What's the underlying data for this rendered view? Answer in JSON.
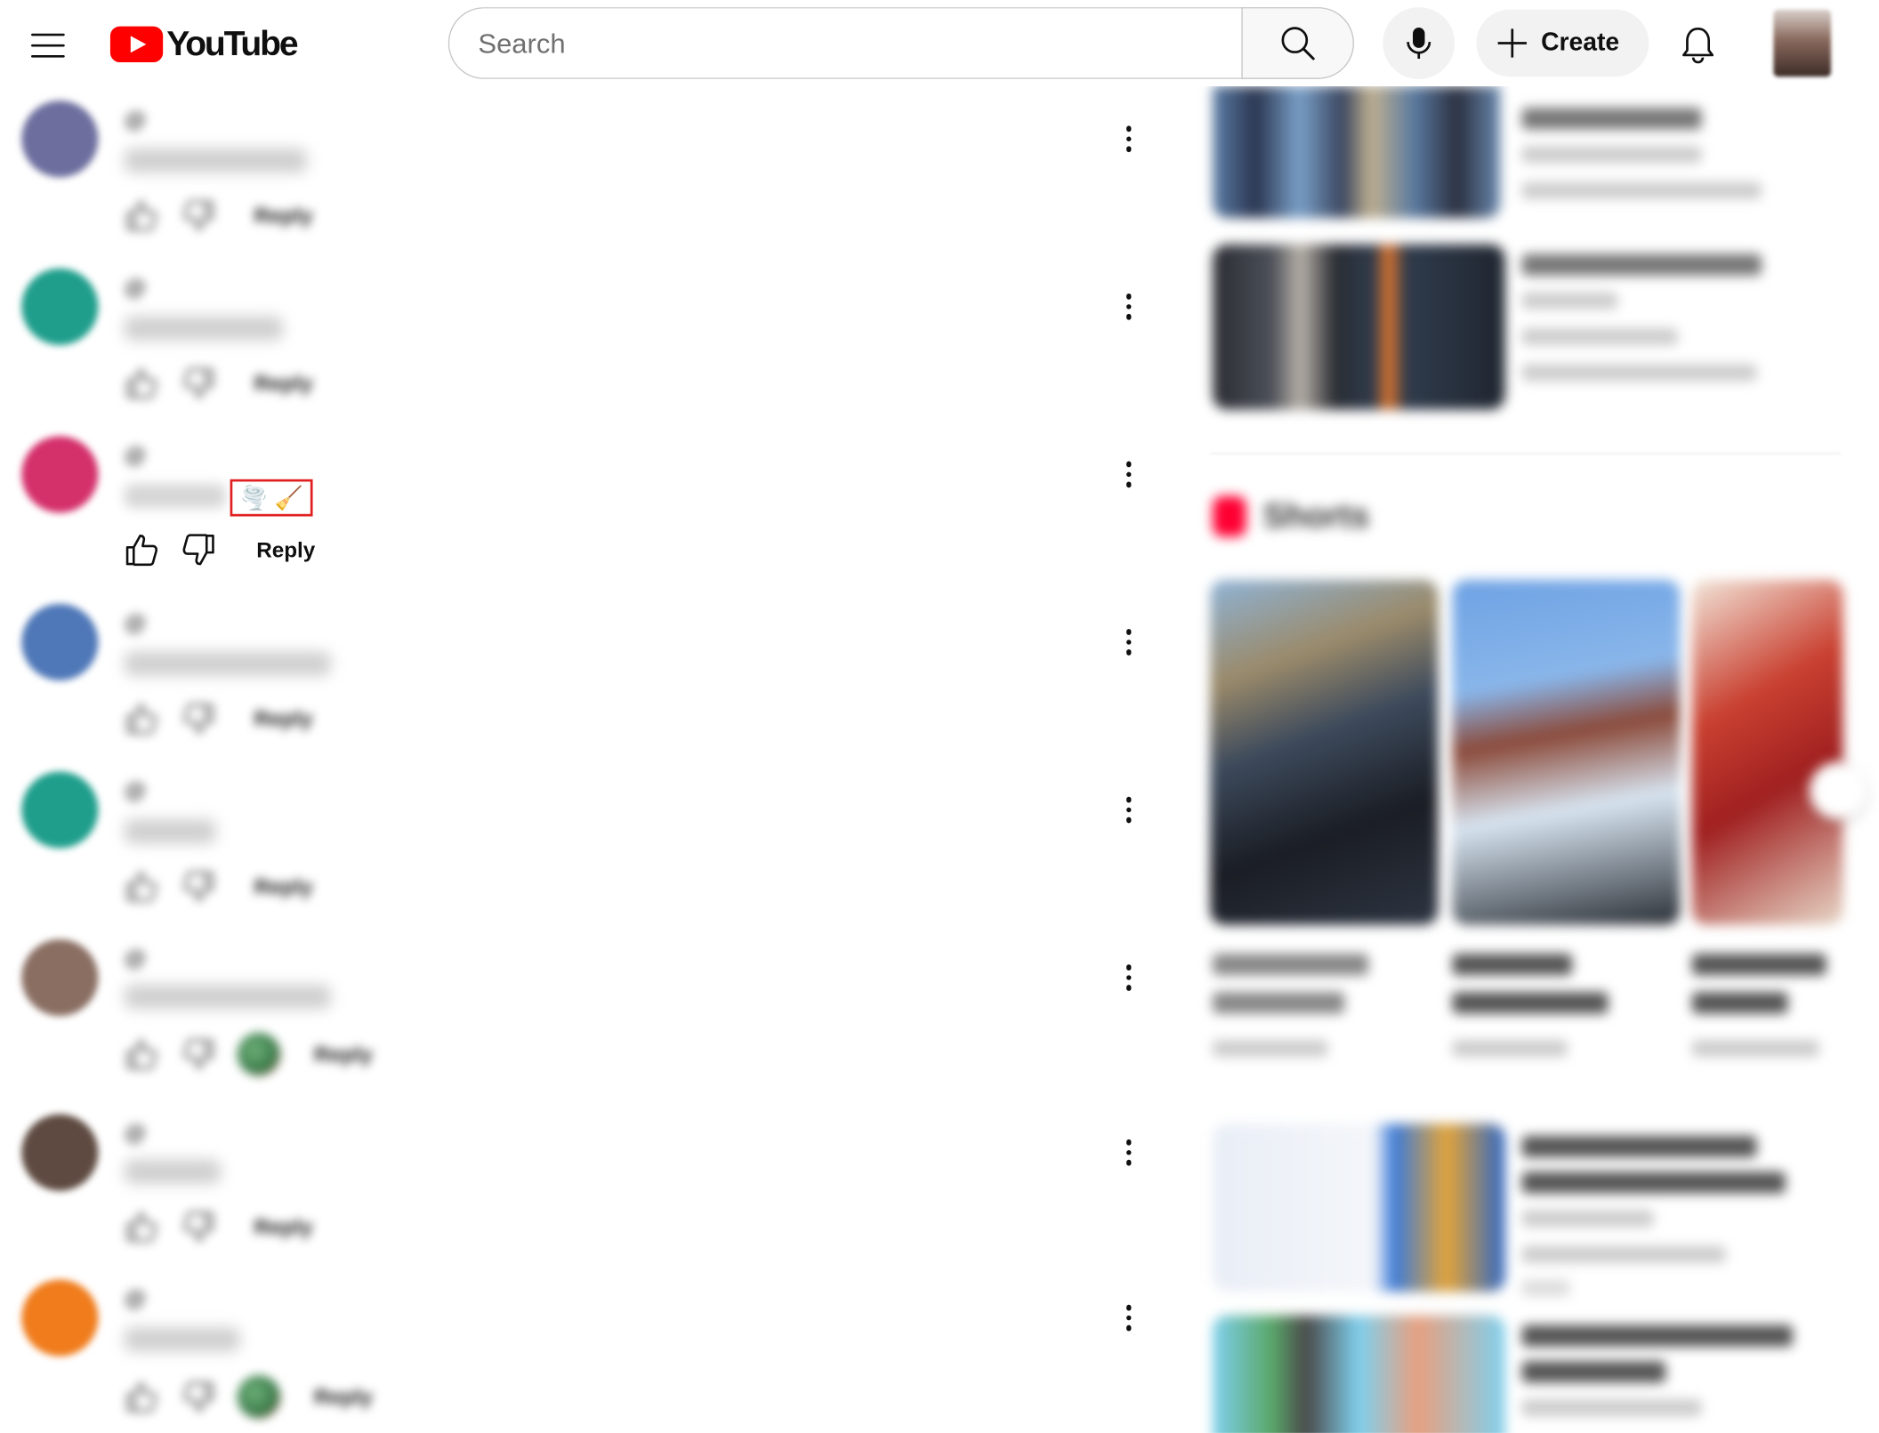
{
  "header": {
    "logo_text": "YouTube",
    "search_placeholder": "Search",
    "create_label": "Create"
  },
  "comments": [
    {
      "user": "@",
      "time": "",
      "text": "",
      "reply_label": "Reply",
      "avatar_color": "#6d6e9e"
    },
    {
      "user": "@",
      "time": "",
      "text": "",
      "reply_label": "Reply",
      "avatar_color": "#1f9e8c"
    },
    {
      "user": "@",
      "time": "",
      "text": "",
      "emojis": "🌪️ 🧹",
      "reply_label": "Reply",
      "avatar_color": "#d4306a"
    },
    {
      "user": "@",
      "time": "",
      "text": "",
      "reply_label": "Reply",
      "avatar_color": "#4f78b8"
    },
    {
      "user": "@",
      "time": "",
      "text": "",
      "reply_label": "Reply",
      "avatar_color": "#1f9e8c"
    },
    {
      "user": "@",
      "time": "",
      "text": "",
      "reply_label": "Reply",
      "avatar_color": "#8a6e62"
    },
    {
      "user": "@",
      "time": "",
      "text": "",
      "reply_label": "Reply",
      "avatar_color": "#5e4a40"
    },
    {
      "user": "@",
      "time": "",
      "text": "",
      "reply_label": "Reply",
      "avatar_color": "#f07c1c"
    }
  ],
  "sidebar": {
    "shorts_heading": "Shorts"
  },
  "colors": {
    "brand_red": "#ff0000",
    "highlight_box": "#e02020"
  }
}
